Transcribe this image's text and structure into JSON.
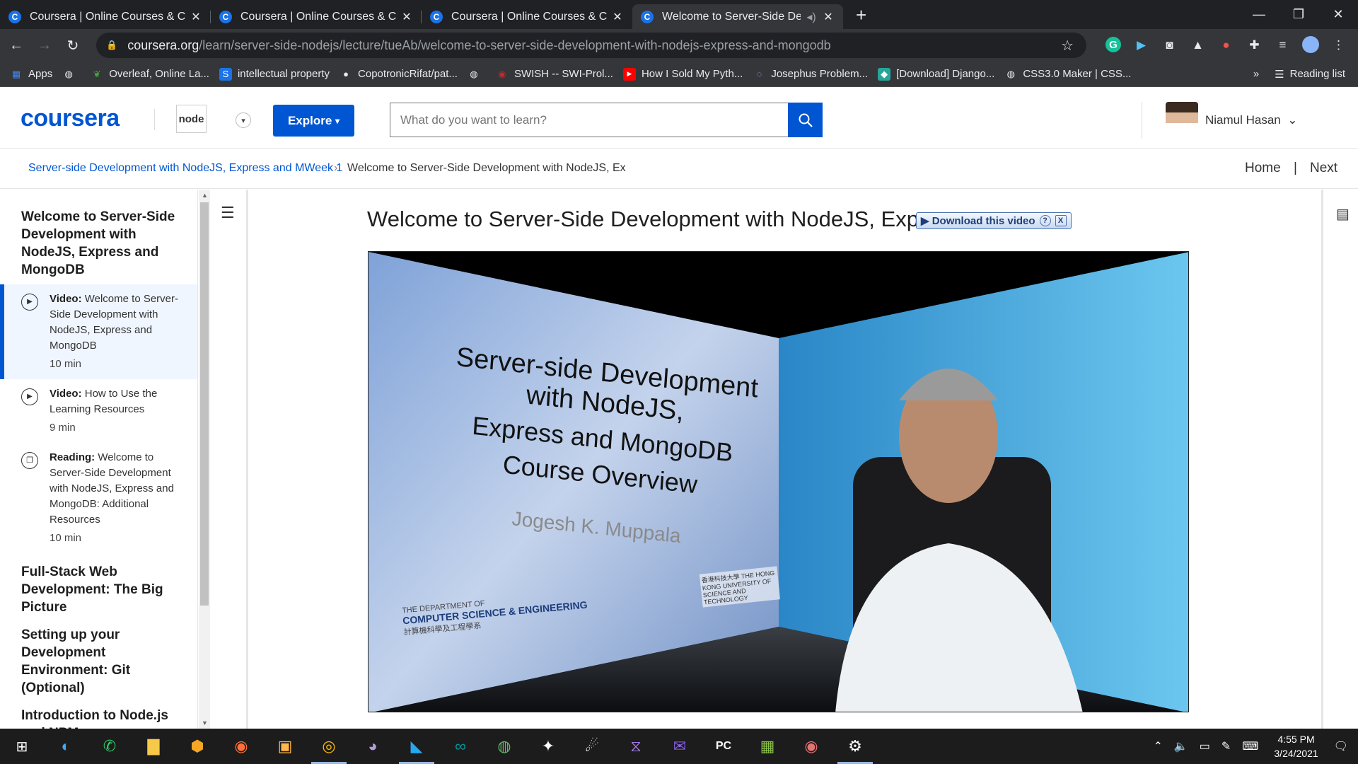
{
  "browser": {
    "tabs": [
      {
        "title": "Coursera | Online Courses & Credentials",
        "active": false
      },
      {
        "title": "Coursera | Online Courses & Credentials",
        "active": false
      },
      {
        "title": "Coursera | Online Courses & Credentials",
        "active": false
      },
      {
        "title": "Welcome to Server-Side Development",
        "active": true
      }
    ],
    "url_host": "coursera.org",
    "url_path": "/learn/server-side-nodejs/lecture/tueAb/welcome-to-server-side-development-with-nodejs-express-and-mongodb",
    "bookmarks": [
      {
        "label": "Apps",
        "icon": "apps-grid-icon",
        "color": "#4285f4"
      },
      {
        "label": "",
        "icon": "globe-icon",
        "color": "#e8eaed"
      },
      {
        "label": "Overleaf, Online La...",
        "icon": "overleaf-icon",
        "color": "#47a141"
      },
      {
        "label": "intellectual property",
        "icon": "s-icon",
        "color": "#1a73e8"
      },
      {
        "label": "CopotronicRifat/pat...",
        "icon": "github-icon",
        "color": "#ffffff"
      },
      {
        "label": "",
        "icon": "globe-icon",
        "color": "#e8eaed"
      },
      {
        "label": "SWISH -- SWI-Prol...",
        "icon": "swish-icon",
        "color": "#c62828"
      },
      {
        "label": "How I Sold My Pyth...",
        "icon": "youtube-icon",
        "color": "#ff0000"
      },
      {
        "label": "Josephus Problem...",
        "icon": "loading-icon",
        "color": "#8ab4f8"
      },
      {
        "label": "[Download] Django...",
        "icon": "django-icon",
        "color": "#26a69a"
      },
      {
        "label": "CSS3.0 Maker | CSS...",
        "icon": "globe-icon",
        "color": "#e8eaed"
      }
    ],
    "more_bookmarks": "»",
    "reading_list": "Reading list"
  },
  "header": {
    "logo": "coursera",
    "explore_label": "Explore",
    "search_placeholder": "What do you want to learn?",
    "user_name": "Niamul Hasan",
    "course_logo_text": "node"
  },
  "breadcrumb": {
    "course": "Server-side Development with NodeJS, Express and MWeek 1",
    "separator": "›",
    "current": "Welcome to Server-Side Development with NodeJS, Ex",
    "home": "Home",
    "divider": "|",
    "next": "Next"
  },
  "sidebar": {
    "section1": "Welcome to Server-Side Development with NodeJS, Express and MongoDB",
    "items": [
      {
        "type": "Video:",
        "title": "Welcome to Server-Side Development with NodeJS, Express and MongoDB",
        "duration": "10 min",
        "active": true,
        "icon": "play-icon"
      },
      {
        "type": "Video:",
        "title": "How to Use the Learning Resources",
        "duration": "9 min",
        "active": false,
        "icon": "play-icon"
      },
      {
        "type": "Reading:",
        "title": "Welcome to Server-Side Development with NodeJS, Express and MongoDB: Additional Resources",
        "duration": "10 min",
        "active": false,
        "icon": "book-icon"
      }
    ],
    "section2": "Full-Stack Web Development: The Big Picture",
    "section3": "Setting up your Development Environment: Git (Optional)",
    "section4": "Introduction to Node.js and NPM"
  },
  "main": {
    "video_title": "Welcome to Server-Side Development with NodeJS, Expres",
    "download_label": "▶ Download this video",
    "download_help": "?",
    "download_close": "X",
    "slide": {
      "line1": "Server-side Development with NodeJS,",
      "line2": "Express and MongoDB",
      "line3": "Course Overview",
      "author": "Jogesh K. Muppala",
      "dept_small": "THE DEPARTMENT OF",
      "dept": "COMPUTER SCIENCE & ENGINEERING",
      "dept_cn": "計算機科學及工程學系",
      "univ": "香港科技大學 THE HONG KONG UNIVERSITY OF SCIENCE AND TECHNOLOGY"
    }
  },
  "taskbar": {
    "time": "4:55 PM",
    "date": "3/24/2021"
  }
}
